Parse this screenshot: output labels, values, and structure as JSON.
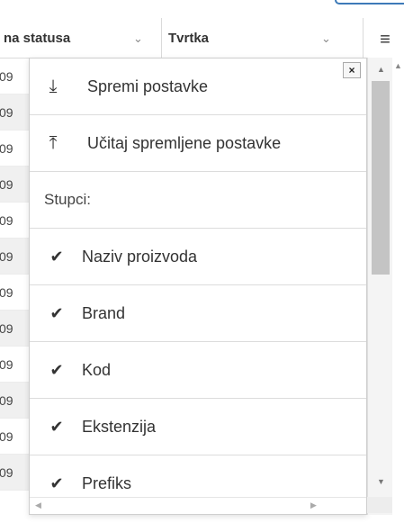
{
  "header": {
    "col1_label": "na statusa",
    "col2_label": "Tvrtka",
    "sort_glyph": "⌄",
    "menu_glyph": "≡"
  },
  "grid": {
    "row_fragment": "09"
  },
  "popup": {
    "close_glyph": "×",
    "items": [
      {
        "icon": "download-icon",
        "glyph": "⤓",
        "label": "Spremi postavke"
      },
      {
        "icon": "upload-icon",
        "glyph": "⤒",
        "label": "Učitaj spremljene postavke"
      },
      {
        "label": "Stupci:"
      },
      {
        "icon": "check-icon",
        "glyph": "✔",
        "label": "Naziv proizvoda"
      },
      {
        "icon": "check-icon",
        "glyph": "✔",
        "label": "Brand"
      },
      {
        "icon": "check-icon",
        "glyph": "✔",
        "label": "Kod"
      },
      {
        "icon": "check-icon",
        "glyph": "✔",
        "label": "Ekstenzija"
      },
      {
        "icon": "check-icon",
        "glyph": "✔",
        "label": "Prefiks"
      }
    ]
  },
  "scroll": {
    "up_glyph": "▲",
    "down_glyph": "▼",
    "left_glyph": "◀",
    "right_glyph": "▶"
  }
}
